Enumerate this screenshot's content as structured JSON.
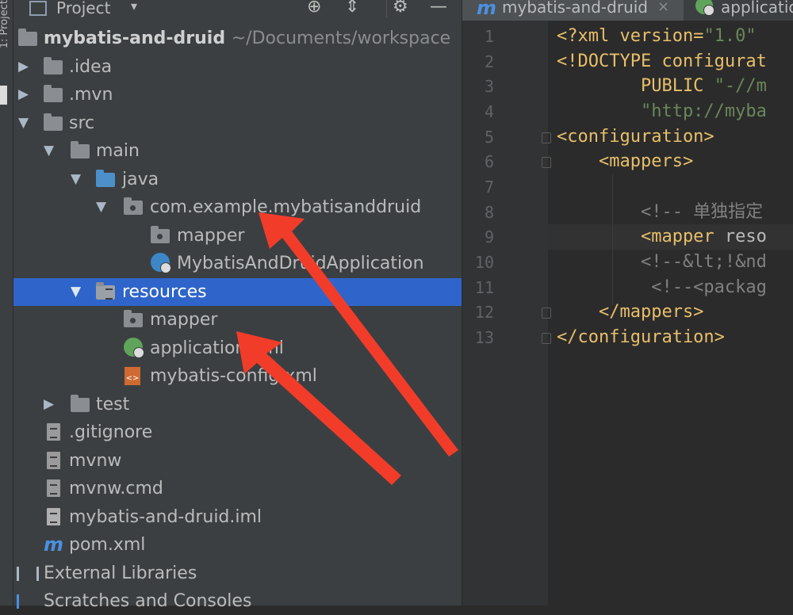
{
  "panel": {
    "title": "Project",
    "dropdown": "▾",
    "toolbar_icons": [
      "crosshair-icon",
      "collapse-icon",
      "gear-icon",
      "minimize-icon"
    ]
  },
  "tree": [
    {
      "label": "mybatis-and-druid",
      "path": "~/Documents/workspace",
      "icon": "module-folder-icon",
      "expanded": true,
      "bold": true
    },
    {
      "label": ".idea",
      "icon": "folder-icon",
      "expanded": false
    },
    {
      "label": ".mvn",
      "icon": "folder-icon",
      "expanded": false
    },
    {
      "label": "src",
      "icon": "folder-icon",
      "expanded": true
    },
    {
      "label": "main",
      "icon": "folder-icon",
      "expanded": true
    },
    {
      "label": "java",
      "icon": "source-folder-icon",
      "expanded": true
    },
    {
      "label": "com.example.mybatisanddruid",
      "icon": "package-icon",
      "expanded": true
    },
    {
      "label": "mapper",
      "icon": "package-icon"
    },
    {
      "label": "MybatisAndDruidApplication",
      "icon": "spring-boot-class-icon"
    },
    {
      "label": "resources",
      "icon": "resources-folder-icon",
      "expanded": true,
      "selected": true
    },
    {
      "label": "mapper",
      "icon": "package-icon"
    },
    {
      "label": "application.yml",
      "icon": "spring-config-icon"
    },
    {
      "label": "mybatis-config.xml",
      "icon": "xml-config-icon"
    },
    {
      "label": "test",
      "icon": "folder-icon",
      "expanded": false
    },
    {
      "label": ".gitignore",
      "icon": "text-file-icon"
    },
    {
      "label": "mvnw",
      "icon": "text-file-icon"
    },
    {
      "label": "mvnw.cmd",
      "icon": "text-file-icon"
    },
    {
      "label": "mybatis-and-druid.iml",
      "icon": "iml-file-icon"
    },
    {
      "label": "pom.xml",
      "icon": "maven-icon"
    },
    {
      "label": "External Libraries",
      "icon": "libraries-icon"
    },
    {
      "label": "Scratches and Consoles",
      "icon": "scratches-icon"
    }
  ],
  "tabs": [
    {
      "label": "mybatis-and-druid",
      "icon": "maven-icon",
      "close": "×"
    },
    {
      "label": "applicatio",
      "icon": "spring-config-icon"
    }
  ],
  "editor": {
    "line_numbers": [
      "1",
      "2",
      "3",
      "4",
      "5",
      "6",
      "7",
      "8",
      "9",
      "10",
      "11",
      "12",
      "13"
    ],
    "lines": [
      [
        {
          "t": "<?xml version=",
          "c": "#e8bf6a"
        },
        {
          "t": "\"1.0\"",
          "c": "#6a8759"
        }
      ],
      [
        {
          "t": "<!DOCTYPE configurat",
          "c": "#e8bf6a"
        }
      ],
      [
        {
          "t": "        PUBLIC ",
          "c": "#e8bf6a"
        },
        {
          "t": "\"-//m",
          "c": "#6a8759"
        }
      ],
      [
        {
          "t": "        \"http://myba",
          "c": "#6a8759"
        }
      ],
      [
        {
          "t": "<configuration>",
          "c": "#e8bf6a"
        }
      ],
      [
        {
          "t": "    <mappers>",
          "c": "#e8bf6a"
        }
      ],
      [
        {
          "t": "",
          "c": "#a9b7c6"
        }
      ],
      [
        {
          "t": "        <!-- 单独指定",
          "c": "#808080"
        }
      ],
      [
        {
          "t": "        <mapper ",
          "c": "#e8bf6a"
        },
        {
          "t": "reso",
          "c": "#bababa"
        }
      ],
      [
        {
          "t": "        <!--&lt;!&nd",
          "c": "#808080"
        }
      ],
      [
        {
          "t": "         <!--<packag",
          "c": "#808080"
        }
      ],
      [
        {
          "t": "    </mappers>",
          "c": "#e8bf6a"
        }
      ],
      [
        {
          "t": "</configuration>",
          "c": "#e8bf6a"
        }
      ]
    ]
  },
  "colors": {
    "selection": "#2f65ca",
    "annotation_arrow": "#f23c2a"
  }
}
